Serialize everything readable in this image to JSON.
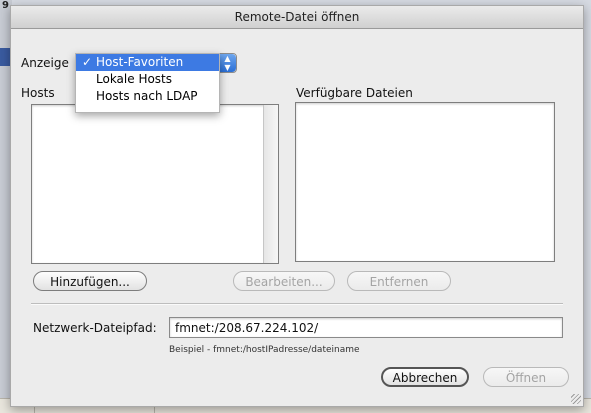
{
  "window": {
    "title": "Remote-Datei öffnen"
  },
  "background": {
    "corner_number": "9"
  },
  "show": {
    "label": "Anzeige",
    "selected": "Host-Favoriten",
    "options": [
      {
        "label": "Host-Favoriten",
        "checked": true
      },
      {
        "label": "Lokale Hosts",
        "checked": false
      },
      {
        "label": "Hosts nach LDAP",
        "checked": false
      }
    ],
    "check_glyph": "✓"
  },
  "hosts": {
    "label": "Hosts"
  },
  "files": {
    "label": "Verfügbare Dateien"
  },
  "buttons": {
    "add": "Hinzufügen...",
    "edit": "Bearbeiten...",
    "remove": "Entfernen",
    "cancel": "Abbrechen",
    "open": "Öffnen"
  },
  "path": {
    "label": "Netzwerk-Dateipfad:",
    "value": "fmnet:/208.67.224.102/",
    "hint": "Beispiel - fmnet:/hostIPadresse/dateiname"
  },
  "colors": {
    "menu_highlight": "#3d7ae3",
    "popup_arrow": "#2b6fd6"
  }
}
